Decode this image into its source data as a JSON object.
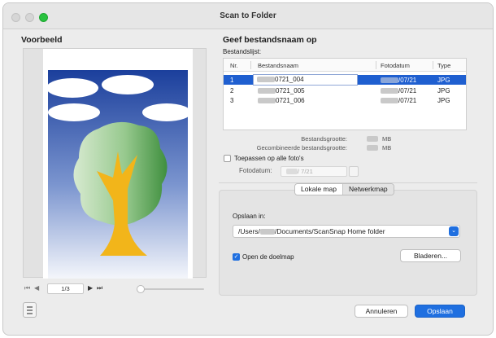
{
  "window": {
    "title": "Scan to Folder"
  },
  "preview": {
    "title": "Voorbeeld",
    "page_indicator": "1/3"
  },
  "file_name": {
    "title": "Geef bestandsnaam op",
    "list_label": "Bestandslijst:",
    "columns": {
      "no": "Nr.",
      "name": "Bestandsnaam",
      "date": "Fotodatum",
      "type": "Type"
    },
    "rows": [
      {
        "no": "1",
        "name_suffix": "0721_004",
        "date_suffix": "/07/21",
        "type": "JPG"
      },
      {
        "no": "2",
        "name_suffix": "0721_005",
        "date_suffix": "/07/21",
        "type": "JPG"
      },
      {
        "no": "3",
        "name_suffix": "0721_006",
        "date_suffix": "/07/21",
        "type": "JPG"
      }
    ],
    "file_size_label": "Bestandsgrootte:",
    "file_size_unit": "MB",
    "combined_size_label": "Gecombineerde bestandsgrootte:",
    "combined_size_unit": "MB",
    "apply_all_label": "Toepassen op alle foto's",
    "photo_date_label": "Fotodatum:",
    "photo_date_value": "/ 7/21"
  },
  "save": {
    "tabs": [
      {
        "label": "Lokale map",
        "active": true
      },
      {
        "label": "Netwerkmap",
        "active": false
      }
    ],
    "save_in_label": "Opslaan in:",
    "path_prefix": "/Users/",
    "path_suffix": "/Documents/ScanSnap Home folder",
    "open_folder_label": "Open de doelmap",
    "open_folder_checked": true,
    "browse_label": "Bladeren..."
  },
  "footer": {
    "cancel_label": "Annuleren",
    "save_label": "Opslaan"
  },
  "colors": {
    "accent": "#1f6fe0",
    "selection": "#1f5fd0",
    "tree_trunk": "#f2b51a"
  }
}
